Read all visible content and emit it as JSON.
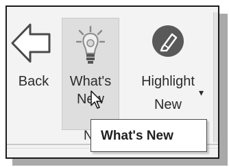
{
  "ribbon": {
    "back": {
      "label": "Back",
      "icon": "back-arrow-icon"
    },
    "whats_new": {
      "label_line1": "What's",
      "label_line2": "New",
      "icon": "lightbulb-icon",
      "state": "hovered"
    },
    "highlight_new": {
      "label_line1": "Highlight",
      "label_line2": "New",
      "icon": "highlighter-icon",
      "dropdown": "▾"
    },
    "group_label_fragment": "N"
  },
  "tooltip": {
    "text": "What's New"
  },
  "colors": {
    "highlight_icon": "#595959",
    "hover_bg": "#dedede",
    "ribbon_bg": "#f3f3f3"
  }
}
